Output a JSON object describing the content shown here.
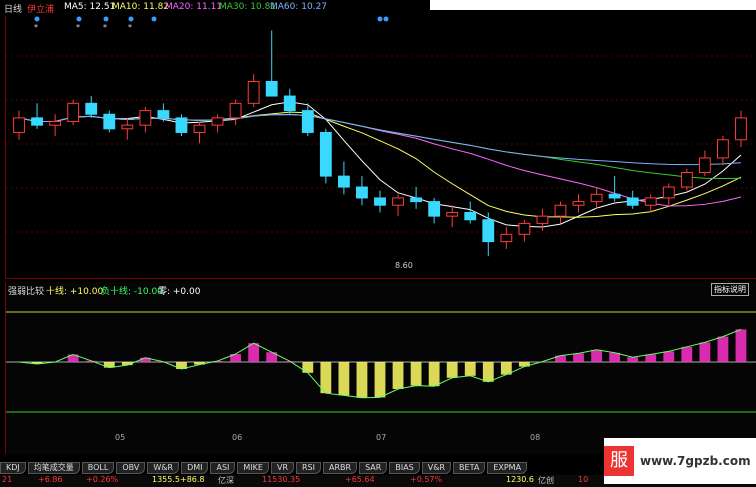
{
  "topbar": {
    "period": "日线",
    "stock": "伊立浦",
    "ma5": "MA5: 12.51",
    "ma10": "MA10: 11.82",
    "ma20": "MA20: 11.11",
    "ma30": "MA30: 10.81",
    "ma60": "MA60: 10.27"
  },
  "price_low_label": "8.60",
  "oscillator": {
    "title": "强弱比较",
    "pos_line": "十线: +10.00",
    "neg_line": "负十线: -10.00",
    "zero_line": "零: +0.00",
    "note_button": "指标说明"
  },
  "x_axis": [
    "05",
    "06",
    "07",
    "08"
  ],
  "tabs": [
    "KDJ",
    "均笔成交量",
    "BOLL",
    "OBV",
    "W&R",
    "DMI",
    "ASI",
    "MIKE",
    "VR",
    "RSI",
    "ARBR",
    "SAR",
    "BIAS",
    "V&R",
    "BETA",
    "EXPMA"
  ],
  "status": {
    "s1": "21",
    "s2": "+6.86",
    "s3": "+0.26%",
    "s4": "1355.5+86.8",
    "s5": "亿深",
    "s6": "11530.35",
    "s7": "+65.64",
    "s8": "+0.57%",
    "s9": "1230.6",
    "s10": "亿创",
    "s11": "10"
  },
  "watermark": {
    "logo": "服",
    "site": "www.7gpzb.com"
  },
  "colors": {
    "up": "#ff3b3b",
    "down": "#38d8ff",
    "ma5": "#ffffff",
    "ma10": "#ffff66",
    "ma20": "#ff66ff",
    "ma30": "#33cc33",
    "ma60": "#7fb0ff"
  },
  "chart_data": {
    "type": "candlestick",
    "title": "",
    "candles": [
      [
        12.0,
        12.6,
        11.8,
        12.4
      ],
      [
        12.4,
        12.8,
        12.1,
        12.2
      ],
      [
        12.2,
        12.5,
        11.9,
        12.3
      ],
      [
        12.3,
        12.9,
        12.2,
        12.8
      ],
      [
        12.8,
        13.0,
        12.4,
        12.5
      ],
      [
        12.5,
        12.6,
        12.0,
        12.1
      ],
      [
        12.1,
        12.4,
        11.8,
        12.2
      ],
      [
        12.2,
        12.7,
        12.0,
        12.6
      ],
      [
        12.6,
        12.8,
        12.3,
        12.4
      ],
      [
        12.4,
        12.5,
        11.9,
        12.0
      ],
      [
        12.0,
        12.3,
        11.7,
        12.2
      ],
      [
        12.2,
        12.5,
        12.0,
        12.4
      ],
      [
        12.4,
        12.9,
        12.2,
        12.8
      ],
      [
        12.8,
        13.6,
        12.7,
        13.4
      ],
      [
        13.4,
        14.8,
        13.2,
        13.0
      ],
      [
        13.0,
        13.2,
        12.5,
        12.6
      ],
      [
        12.6,
        12.8,
        11.9,
        12.0
      ],
      [
        12.0,
        12.1,
        10.6,
        10.8
      ],
      [
        10.8,
        11.2,
        10.3,
        10.5
      ],
      [
        10.5,
        10.8,
        10.0,
        10.2
      ],
      [
        10.2,
        10.4,
        9.8,
        10.0
      ],
      [
        10.0,
        10.3,
        9.7,
        10.2
      ],
      [
        10.2,
        10.5,
        9.9,
        10.1
      ],
      [
        10.1,
        10.2,
        9.5,
        9.7
      ],
      [
        9.7,
        10.0,
        9.4,
        9.8
      ],
      [
        9.8,
        10.1,
        9.5,
        9.6
      ],
      [
        9.6,
        9.8,
        8.6,
        9.0
      ],
      [
        9.0,
        9.4,
        8.8,
        9.2
      ],
      [
        9.2,
        9.6,
        9.0,
        9.5
      ],
      [
        9.5,
        9.9,
        9.3,
        9.7
      ],
      [
        9.7,
        10.1,
        9.5,
        10.0
      ],
      [
        10.0,
        10.3,
        9.8,
        10.1
      ],
      [
        10.1,
        10.5,
        9.9,
        10.3
      ],
      [
        10.3,
        10.8,
        10.1,
        10.2
      ],
      [
        10.2,
        10.4,
        9.9,
        10.0
      ],
      [
        10.0,
        10.3,
        9.8,
        10.2
      ],
      [
        10.2,
        10.6,
        10.0,
        10.5
      ],
      [
        10.5,
        11.0,
        10.4,
        10.9
      ],
      [
        10.9,
        11.5,
        10.8,
        11.3
      ],
      [
        11.3,
        11.9,
        11.1,
        11.8
      ],
      [
        11.8,
        12.6,
        11.6,
        12.4
      ]
    ],
    "low_marker": 8.6
  }
}
